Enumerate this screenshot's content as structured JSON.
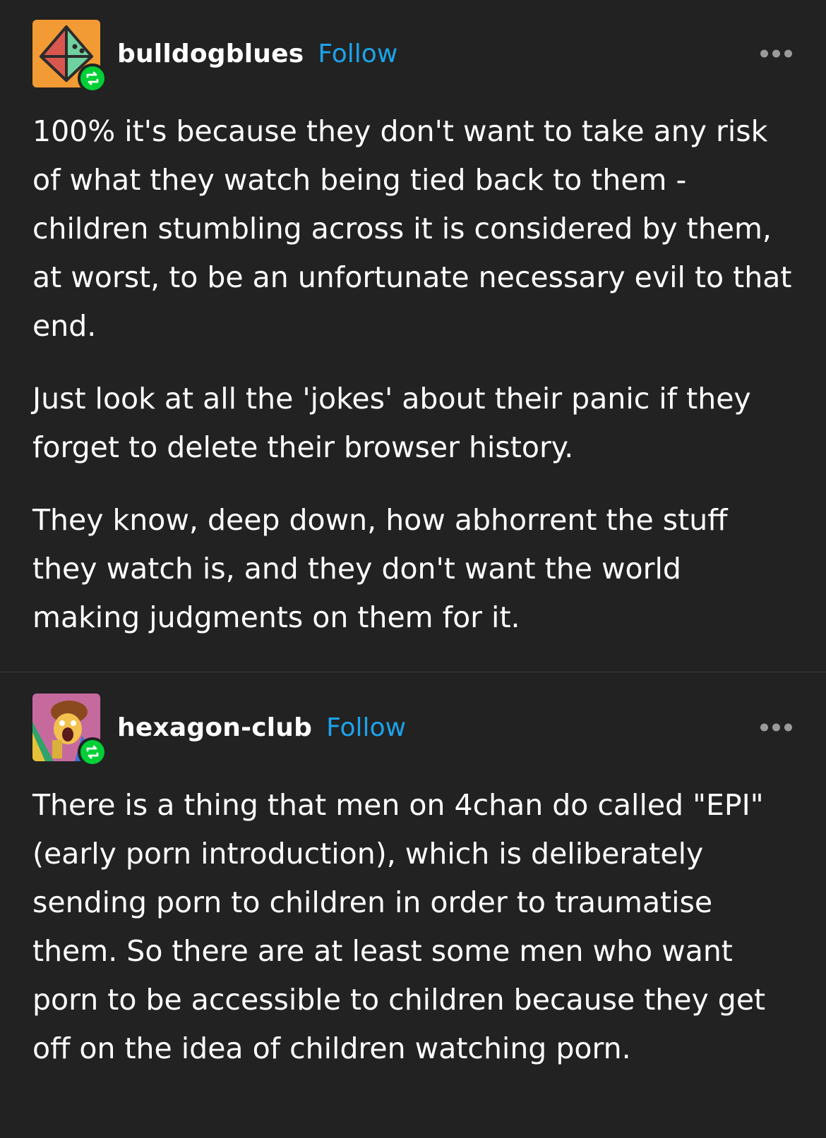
{
  "posts": [
    {
      "username": "bulldogblues",
      "follow_label": "Follow",
      "avatar_icon": "orange-d20-dice-avatar",
      "badge_icon": "reblog-icon",
      "paragraphs": [
        "100% it's because they don't want to take any risk of what they watch being tied back to them - children stumbling across it is considered by them, at worst, to be an unfortunate necessary evil to that end.",
        "Just look at all the 'jokes' about their panic if they forget to delete their browser history.",
        "They know, deep down, how abhorrent the stuff they watch is, and they don't want the world making judgments on them for it."
      ]
    },
    {
      "username": "hexagon-club",
      "follow_label": "Follow",
      "avatar_icon": "cartoon-character-avatar",
      "badge_icon": "reblog-icon",
      "paragraphs": [
        "There is a thing that men on 4chan do called \"EPI\" (early porn introduction), which is deliberately sending porn to children in order to traumatise them. So there are at least some men who want porn to be accessible to children because they get off on the idea of children watching porn."
      ]
    }
  ],
  "colors": {
    "background": "#222222",
    "text": "#ffffff",
    "follow": "#1ba4ec",
    "reblog_badge": "#00cf35",
    "more_dots": "#9a9a9a"
  }
}
